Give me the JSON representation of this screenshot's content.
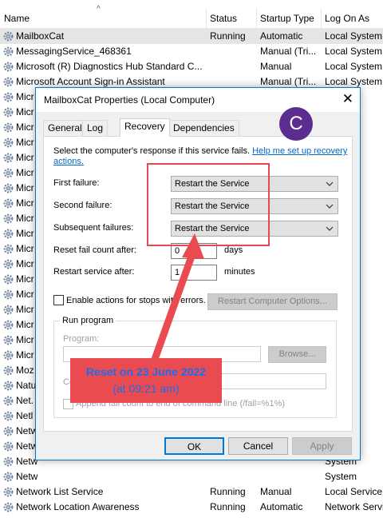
{
  "services": {
    "columns": {
      "name": "Name",
      "status": "Status",
      "startup": "Startup Type",
      "logon": "Log On As"
    },
    "rows": [
      {
        "name": "MailboxCat",
        "status": "Running",
        "startup": "Automatic",
        "logon": "Local System"
      },
      {
        "name": "MessagingService_468361",
        "status": "",
        "startup": "Manual (Tri...",
        "logon": "Local System"
      },
      {
        "name": "Microsoft (R) Diagnostics Hub Standard C...",
        "status": "",
        "startup": "Manual",
        "logon": "Local System"
      },
      {
        "name": "Microsoft Account Sign-in Assistant",
        "status": "",
        "startup": "Manual (Tri...",
        "logon": "Local System"
      },
      {
        "name": "Micr",
        "status": "",
        "startup": "",
        "logon": "c Syste"
      },
      {
        "name": "Micr",
        "status": "",
        "startup": "",
        "logon": "Service"
      },
      {
        "name": "Micr",
        "status": "",
        "startup": "",
        "logon": "Service"
      },
      {
        "name": "Micr",
        "status": "",
        "startup": "",
        "logon": "Service"
      },
      {
        "name": "Micr",
        "status": "",
        "startup": "",
        "logon": "System"
      },
      {
        "name": "Micr",
        "status": "",
        "startup": "",
        "logon": "System"
      },
      {
        "name": "Micr",
        "status": "",
        "startup": "",
        "logon": "System"
      },
      {
        "name": "Micr",
        "status": "",
        "startup": "",
        "logon": "System"
      },
      {
        "name": "Micr",
        "status": "",
        "startup": "",
        "logon": "System"
      },
      {
        "name": "Micr",
        "status": "",
        "startup": "",
        "logon": "System"
      },
      {
        "name": "Micr",
        "status": "",
        "startup": "",
        "logon": "System"
      },
      {
        "name": "Micr",
        "status": "",
        "startup": "",
        "logon": "System"
      },
      {
        "name": "Micr",
        "status": "",
        "startup": "",
        "logon": "Service"
      },
      {
        "name": "Micr",
        "status": "",
        "startup": "",
        "logon": "Service"
      },
      {
        "name": "Micr",
        "status": "",
        "startup": "",
        "logon": "Servi"
      },
      {
        "name": "Micr",
        "status": "",
        "startup": "",
        "logon": "System"
      },
      {
        "name": "Micr",
        "status": "",
        "startup": "",
        "logon": "System"
      },
      {
        "name": "Micr",
        "status": "",
        "startup": "",
        "logon": "System"
      },
      {
        "name": "Moz",
        "status": "",
        "startup": "",
        "logon": "System"
      },
      {
        "name": "Natu",
        "status": "",
        "startup": "",
        "logon": "System"
      },
      {
        "name": "Net.",
        "status": "",
        "startup": "",
        "logon": "Service"
      },
      {
        "name": "Netl",
        "status": "",
        "startup": "",
        "logon": "System"
      },
      {
        "name": "Netw",
        "status": "",
        "startup": "",
        "logon": "System"
      },
      {
        "name": "Netw",
        "status": "",
        "startup": "",
        "logon": "System"
      },
      {
        "name": "Netw",
        "status": "",
        "startup": "",
        "logon": "System"
      },
      {
        "name": "Netw",
        "status": "",
        "startup": "",
        "logon": "System"
      },
      {
        "name": "Network List Service",
        "status": "Running",
        "startup": "Manual",
        "logon": "Local Service"
      },
      {
        "name": "Network Location Awareness",
        "status": "Running",
        "startup": "Automatic",
        "logon": "Network Service"
      }
    ]
  },
  "dialog": {
    "title": "MailboxCat Properties (Local Computer)",
    "tabs": [
      "General",
      "Log On",
      "Recovery",
      "Dependencies"
    ],
    "intro": "Select the computer's response if this service fails.",
    "help_link": "Help me set up recovery actions.",
    "first_failure_label": "First failure:",
    "first_failure_value": "Restart the Service",
    "second_failure_label": "Second failure:",
    "second_failure_value": "Restart the Service",
    "subsequent_label": "Subsequent failures:",
    "subsequent_value": "Restart the Service",
    "reset_label": "Reset fail count after:",
    "reset_value": "0",
    "reset_unit": "days",
    "restart_label": "Restart service after:",
    "restart_value": "1",
    "restart_unit": "minutes",
    "enable_actions_label": "Enable actions for stops with errors.",
    "restart_computer_button": "Restart Computer Options...",
    "run_program_title": "Run program",
    "program_label": "Program:",
    "browse_button": "Browse...",
    "command_label": "Co",
    "append_label": "Append fail count to end of command line (/fail=%1%)",
    "ok": "OK",
    "cancel": "Cancel",
    "apply": "Apply"
  },
  "annotation": {
    "callout_line1": "Reset on 23 June 2022",
    "callout_line2": "(at 09:21 am)",
    "badge": "C"
  },
  "colors": {
    "accent": "#0078d7",
    "annotation_red": "#ea4b50",
    "badge_purple": "#5b2d91",
    "callout_text": "#1e6cf0"
  }
}
